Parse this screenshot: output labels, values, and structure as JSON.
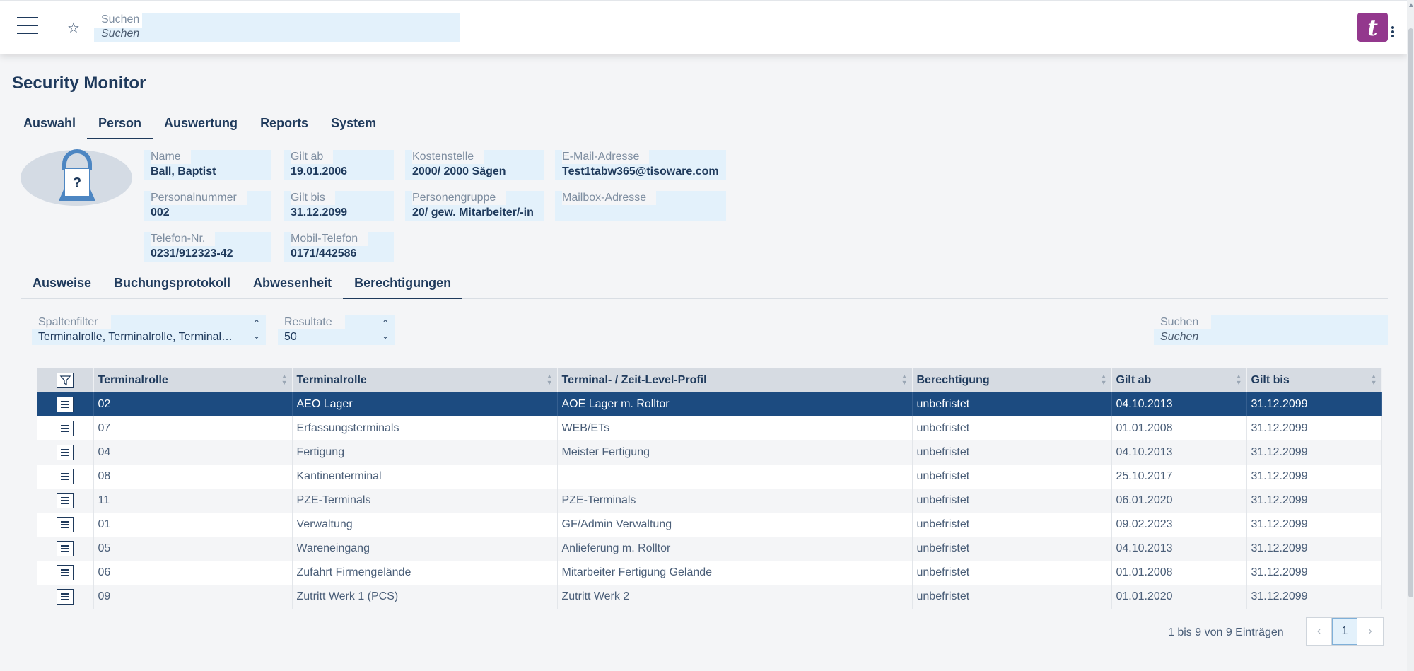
{
  "header": {
    "search_label": "Suchen",
    "search_placeholder": "Suchen",
    "logo_letter": "t"
  },
  "page_title": "Security Monitor",
  "main_tabs": [
    "Auswahl",
    "Person",
    "Auswertung",
    "Reports",
    "System"
  ],
  "main_tab_active": "Person",
  "person": {
    "name": {
      "label": "Name",
      "value": "Ball, Baptist"
    },
    "personalnummer": {
      "label": "Personalnummer",
      "value": "002"
    },
    "telefon": {
      "label": "Telefon-Nr.",
      "value": "0231/912323-42"
    },
    "gilt_ab": {
      "label": "Gilt ab",
      "value": "19.01.2006"
    },
    "gilt_bis": {
      "label": "Gilt bis",
      "value": "31.12.2099"
    },
    "mobil": {
      "label": "Mobil-Telefon",
      "value": "0171/442586"
    },
    "kostenstelle": {
      "label": "Kostenstelle",
      "value": "2000/ 2000 Sägen"
    },
    "personengruppe": {
      "label": "Personengruppe",
      "value": "20/ gew. Mitarbeiter/-in"
    },
    "email": {
      "label": "E-Mail-Adresse",
      "value": "Test1tabw365@tisoware.com"
    },
    "mailbox": {
      "label": "Mailbox-Adresse",
      "value": ""
    }
  },
  "sub_tabs": [
    "Ausweise",
    "Buchungsprotokoll",
    "Abwesenheit",
    "Berechtigungen"
  ],
  "sub_tab_active": "Berechtigungen",
  "filters": {
    "spaltenfilter": {
      "label": "Spaltenfilter",
      "value": "Terminalrolle, Terminalrolle, Terminal…"
    },
    "resultate": {
      "label": "Resultate",
      "value": "50"
    },
    "suchen": {
      "label": "Suchen",
      "placeholder": "Suchen"
    }
  },
  "table": {
    "columns": [
      "Terminalrolle",
      "Terminalrolle",
      "Terminal- / Zeit-Level-Profil",
      "Berechtigung",
      "Gilt ab",
      "Gilt bis"
    ],
    "rows": [
      [
        "02",
        "AEO Lager",
        "AOE Lager m. Rolltor",
        "unbefristet",
        "04.10.2013",
        "31.12.2099"
      ],
      [
        "07",
        "Erfassungsterminals",
        "WEB/ETs",
        "unbefristet",
        "01.01.2008",
        "31.12.2099"
      ],
      [
        "04",
        "Fertigung",
        "Meister Fertigung",
        "unbefristet",
        "04.10.2013",
        "31.12.2099"
      ],
      [
        "08",
        "Kantinenterminal",
        "",
        "unbefristet",
        "25.10.2017",
        "31.12.2099"
      ],
      [
        "11",
        "PZE-Terminals",
        "PZE-Terminals",
        "unbefristet",
        "06.01.2020",
        "31.12.2099"
      ],
      [
        "01",
        "Verwaltung",
        "GF/Admin Verwaltung",
        "unbefristet",
        "09.02.2023",
        "31.12.2099"
      ],
      [
        "05",
        "Wareneingang",
        "Anlieferung m. Rolltor",
        "unbefristet",
        "04.10.2013",
        "31.12.2099"
      ],
      [
        "06",
        "Zufahrt Firmengelände",
        "Mitarbeiter Fertigung Gelände",
        "unbefristet",
        "01.01.2008",
        "31.12.2099"
      ],
      [
        "09",
        "Zutritt Werk 1 (PCS)",
        "Zutritt Werk 2",
        "unbefristet",
        "01.01.2020",
        "31.12.2099"
      ]
    ],
    "selected_row": 0
  },
  "pagination": {
    "info": "1 bis 9 von 9 Einträgen",
    "current_page": "1",
    "prev": "‹",
    "next": "›"
  },
  "colors": {
    "primary": "#1f3a5c",
    "selected_row": "#1c4b80",
    "field_bg": "#e3f1fb",
    "brand": "#93388d"
  }
}
